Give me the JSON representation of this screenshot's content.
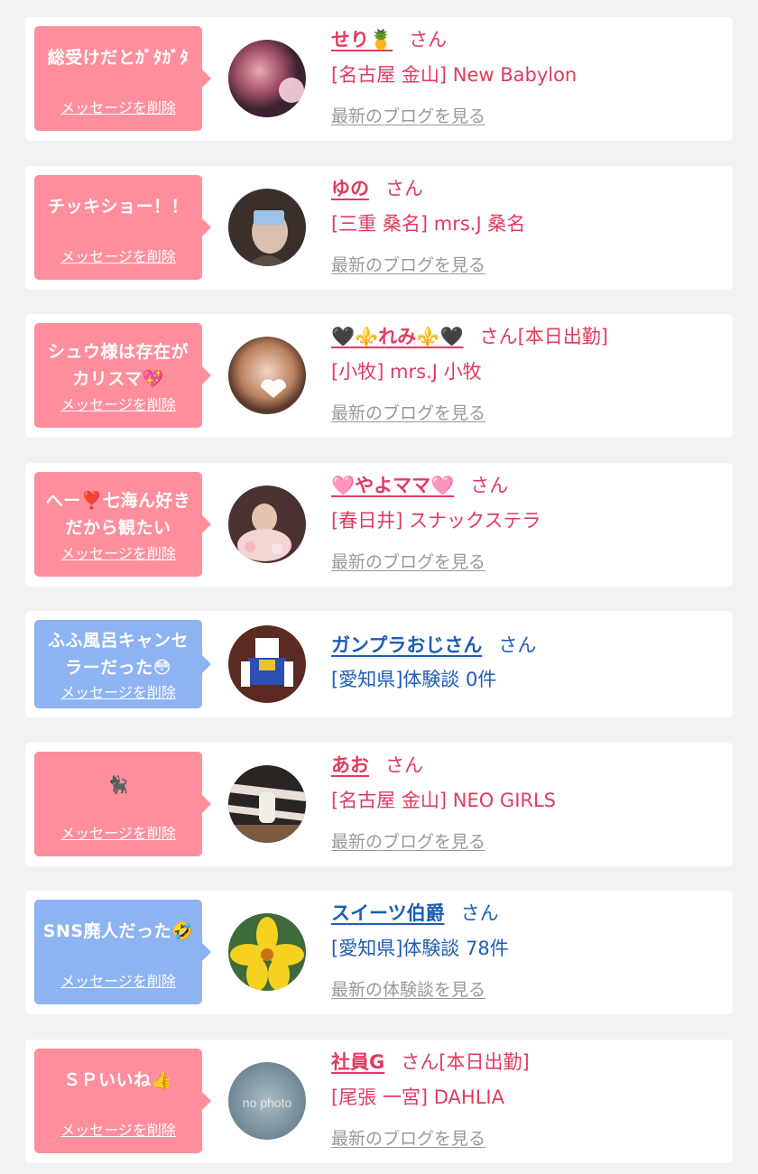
{
  "colors": {
    "pink_bubble": "#fe8e9b",
    "blue_bubble": "#8db3f3",
    "pink_text": "#e03b5f",
    "blue_text": "#1d5db5",
    "link_gray": "#999999",
    "page_bg": "#f2f2f2"
  },
  "delete_label": "メッセージを削除",
  "san_label": "さん",
  "items": [
    {
      "bubble_color": "pink",
      "message": "総受けだとｶﾞﾀｶﾞﾀ",
      "delete_label": "メッセージを削除",
      "name": "せり🍍",
      "suffix": "さん",
      "location": "[名古屋 金山] New Babylon",
      "link": "最新のブログを見る"
    },
    {
      "bubble_color": "pink",
      "message": "チッキショー！！",
      "delete_label": "メッセージを削除",
      "name": "ゆの",
      "suffix": "さん",
      "location": "[三重 桑名] mrs.J 桑名",
      "link": "最新のブログを見る"
    },
    {
      "bubble_color": "pink",
      "message": "シュウ様は存在が\nカリスマ💖",
      "delete_label": "メッセージを削除",
      "name": "🖤⚜️れみ⚜️🖤",
      "suffix": "さん[本日出勤]",
      "location": "[小牧] mrs.J 小牧",
      "link": "最新のブログを見る"
    },
    {
      "bubble_color": "pink",
      "message": "へー❣️七海ん好き\nだから観たい",
      "delete_label": "メッセージを削除",
      "name": "🩷やよママ🩷",
      "suffix": "さん",
      "location": "[春日井] スナックステラ",
      "link": "最新のブログを見る"
    },
    {
      "bubble_color": "blue",
      "message": "ふふ風呂キャンセ\nラーだった😳",
      "delete_label": "メッセージを削除",
      "name": "ガンプラおじさん",
      "suffix": "さん",
      "location": "[愛知県]体験談 0件",
      "link": ""
    },
    {
      "bubble_color": "pink",
      "message": "🐈‍⬛",
      "delete_label": "メッセージを削除",
      "name": "あお",
      "suffix": "さん",
      "location": "[名古屋 金山] NEO GIRLS",
      "link": "最新のブログを見る"
    },
    {
      "bubble_color": "blue",
      "message": "SNS廃人だった🤣",
      "delete_label": "メッセージを削除",
      "name": "スイーツ伯爵",
      "suffix": "さん",
      "location": "[愛知県]体験談 78件",
      "link": "最新の体験談を見る"
    },
    {
      "bubble_color": "pink",
      "message": "ＳＰいいね👍",
      "delete_label": "メッセージを削除",
      "name": "社員G",
      "suffix": "さん[本日出勤]",
      "location": "[尾張 一宮] DAHLIA",
      "link": "最新のブログを見る",
      "avatar_text": "no photo"
    }
  ]
}
